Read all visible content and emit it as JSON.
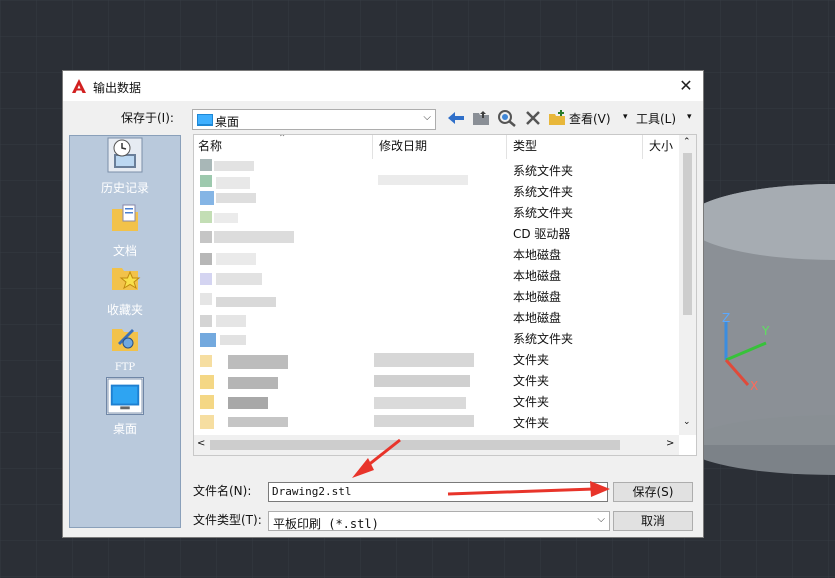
{
  "dialog": {
    "title": "输出数据",
    "save_in_label": "保存于(I):",
    "save_in_value": "桌面",
    "toolbar": {
      "view_label": "查看(V)",
      "tools_label": "工具(L)"
    },
    "places": [
      {
        "label": "历史记录",
        "icon": "history-icon"
      },
      {
        "label": "文档",
        "icon": "documents-icon"
      },
      {
        "label": "收藏夹",
        "icon": "favorites-icon"
      },
      {
        "label": "FTP",
        "icon": "ftp-icon"
      },
      {
        "label": "桌面",
        "icon": "desktop-icon",
        "selected": true
      }
    ],
    "columns": {
      "name": "名称",
      "date": "修改日期",
      "type": "类型",
      "size": "大小"
    },
    "rows": [
      {
        "type": "系统文件夹"
      },
      {
        "type": "系统文件夹"
      },
      {
        "type": "系统文件夹"
      },
      {
        "type": "CD 驱动器"
      },
      {
        "type": "本地磁盘"
      },
      {
        "type": "本地磁盘"
      },
      {
        "type": "本地磁盘"
      },
      {
        "type": "本地磁盘"
      },
      {
        "type": "系统文件夹"
      },
      {
        "type": "文件夹"
      },
      {
        "type": "文件夹"
      },
      {
        "type": "文件夹"
      },
      {
        "type": "文件夹"
      }
    ],
    "filename_label": "文件名(N):",
    "filename_value": "Drawing2.stl",
    "filetype_label": "文件类型(T):",
    "filetype_value": "平板印刷 (*.stl)",
    "save_button": "保存(S)",
    "cancel_button": "取消"
  },
  "colors": {
    "annotation_arrow": "#e8342a",
    "places_bg": "#b9c9dc"
  }
}
